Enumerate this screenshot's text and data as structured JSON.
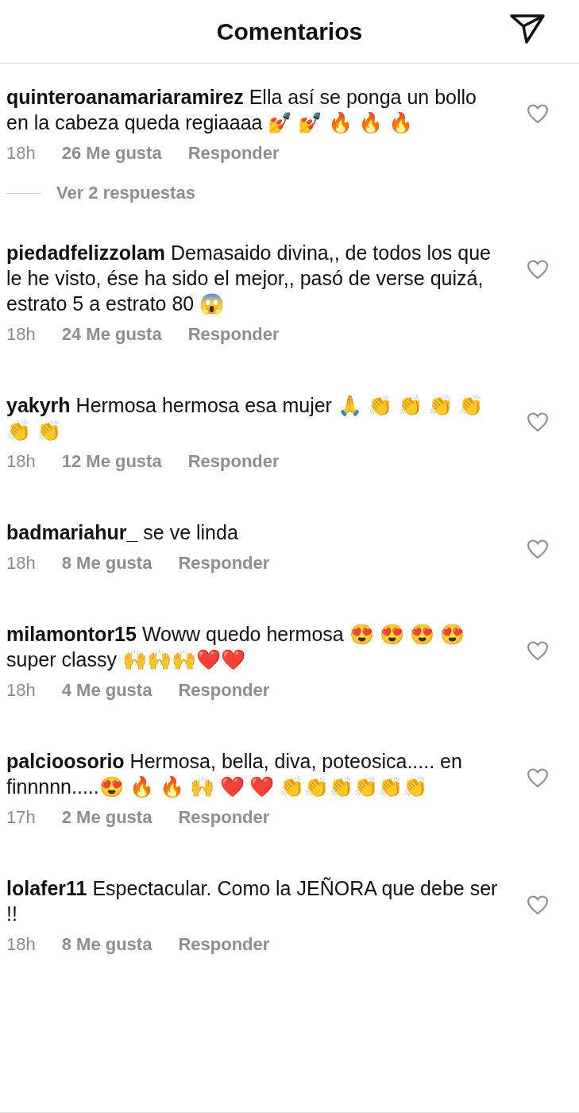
{
  "header": {
    "title": "Comentarios"
  },
  "comments": [
    {
      "username": "quinteroanamariaramirez",
      "text": "Ella así se ponga un bollo en la cabeza queda regiaaaa 💅 💅 🔥 🔥 🔥",
      "time": "18h",
      "likes": "26 Me gusta",
      "reply": "Responder",
      "liked": false,
      "replies_link": "Ver 2 respuestas"
    },
    {
      "username": "piedadfelizzolam",
      "text": "Demasaido divina,, de todos los que le he visto, ése ha sido el mejor,, pasó de verse quizá, estrato 5 a estrato 80 😱",
      "time": "18h",
      "likes": "24 Me gusta",
      "reply": "Responder",
      "liked": false
    },
    {
      "username": "yakyrh",
      "text": "Hermosa hermosa esa mujer 🙏 👏 👏 👏 👏 👏 👏",
      "time": "18h",
      "likes": "12 Me gusta",
      "reply": "Responder",
      "liked": false
    },
    {
      "username": "badmariahur_",
      "text": "se ve linda",
      "time": "18h",
      "likes": "8 Me gusta",
      "reply": "Responder",
      "liked": false
    },
    {
      "username": "milamontor15",
      "text": "Woww quedo hermosa 😍 😍 😍 😍  super classy 🙌🙌🙌❤️❤️",
      "time": "18h",
      "likes": "4 Me gusta",
      "reply": "Responder",
      "liked": false
    },
    {
      "username": "palcioosorio",
      "text": "Hermosa, bella, diva, poteosica..... en finnnnn.....😍 🔥 🔥 🙌 ❤️ ❤️ 👏👏👏👏👏👏",
      "time": "17h",
      "likes": "2 Me gusta",
      "reply": "Responder",
      "liked": false
    },
    {
      "username": "lolafer11",
      "text": "Espectacular. Como la JEÑORA que debe ser !!",
      "time": "18h",
      "likes": "8 Me gusta",
      "reply": "Responder",
      "liked": false
    }
  ]
}
